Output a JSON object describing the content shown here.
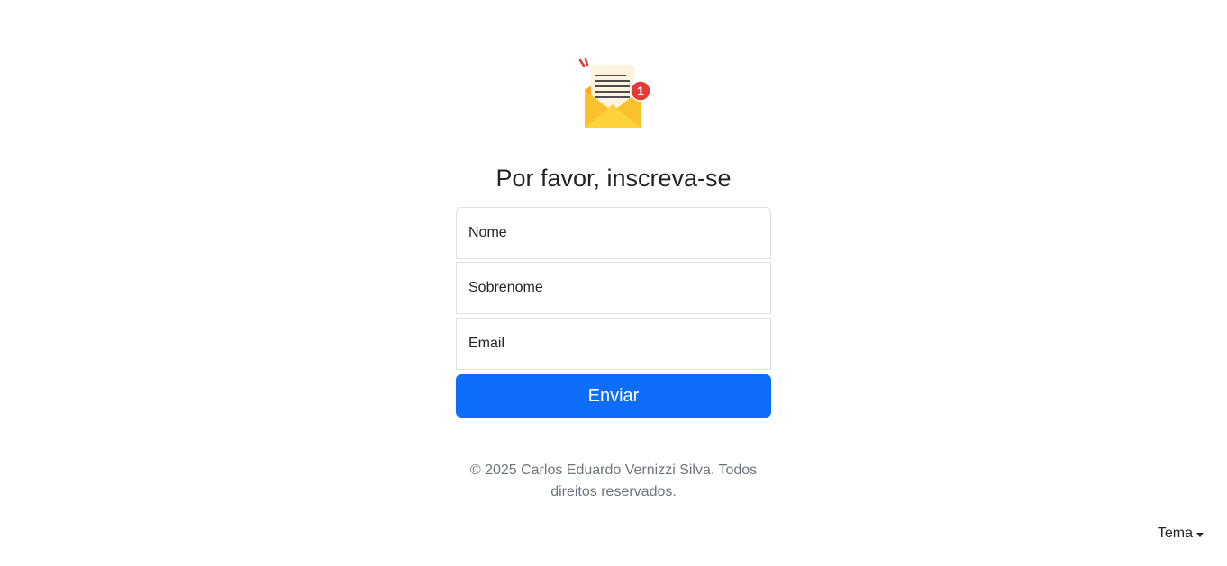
{
  "logo": {
    "icon": "mail-notification-icon",
    "badge_count": "1"
  },
  "title": "Por favor, inscreva-se",
  "form": {
    "first_name_placeholder": "Nome",
    "last_name_placeholder": "Sobrenome",
    "email_placeholder": "Email",
    "submit_label": "Enviar"
  },
  "footer": {
    "text": "© 2025 Carlos Eduardo Vernizzi Silva. Todos direitos reservados."
  },
  "theme_menu": {
    "label": "Tema"
  },
  "colors": {
    "primary": "#0d6efd",
    "envelope": "#fbc02d",
    "badge": "#e53935"
  }
}
